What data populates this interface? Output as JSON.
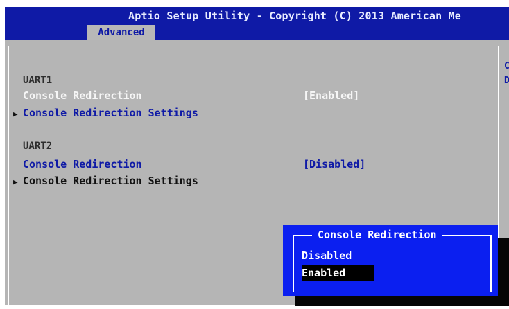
{
  "header": {
    "title": "Aptio Setup Utility - Copyright (C) 2013 American Me",
    "active_tab": "Advanced"
  },
  "help_panel": {
    "lines": [
      "C",
      "D"
    ]
  },
  "menu": {
    "uart1": {
      "heading": "UART1",
      "console_redirection_label": "Console Redirection",
      "console_redirection_value": "[Enabled]",
      "settings_label": "Console Redirection Settings"
    },
    "uart2": {
      "heading": "UART2",
      "console_redirection_label": "Console Redirection",
      "console_redirection_value": "[Disabled]",
      "settings_label": "Console Redirection Settings"
    }
  },
  "popup": {
    "title": "Console Redirection",
    "options": [
      "Disabled",
      "Enabled"
    ],
    "selected": "Enabled"
  },
  "colors": {
    "header_bg": "#0f1aa6",
    "panel_bg": "#b5b5b5",
    "popup_bg": "#0b1ff0",
    "text_blue": "#0f1aa6",
    "selected_text": "#f6f6f6"
  }
}
